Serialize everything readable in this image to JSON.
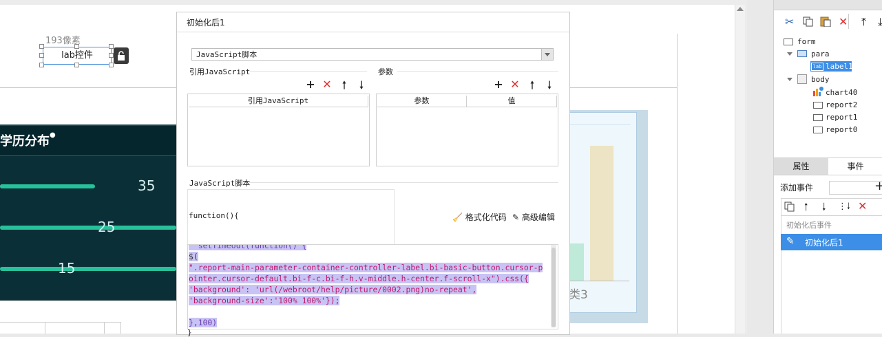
{
  "canvas": {
    "para_label_hint": "193像素",
    "label_widget_text": "lab控件",
    "dark_chart": {
      "title": "学历分布",
      "bars": [
        {
          "value": "35",
          "fill": 0.54,
          "track": 0.76
        },
        {
          "value": "25",
          "fill": 1.0,
          "track": 1.0
        },
        {
          "value": "15",
          "fill": 1.0,
          "track": 1.0
        }
      ],
      "colors": {
        "bg": "#06262d",
        "bar": "#27c19b",
        "track": "#8ee6f2"
      }
    },
    "right_chart": {
      "category_label": "类3"
    }
  },
  "dialog": {
    "title": "初始化后1",
    "script_type": "JavaScript脚本",
    "ref_js_section": "引用JavaScript",
    "params_section": "参数",
    "ref_js_col": "引用JavaScript",
    "param_col": "参数",
    "value_col": "值",
    "script_section": "JavaScript脚本",
    "function_header": "function(){",
    "format_btn": "格式化代码",
    "advanced_btn": "高级编辑",
    "code": {
      "line0": "  setTimeout(function() {",
      "line1": "$(",
      "line2": "\".report-main-parameter-container-controller-label.bi-basic-button.cursor-p",
      "line3": "ointer.cursor-default.bi-f-c.bi-f-h.v-middle.h-center.f-scroll-x\").css({",
      "line4": "'background': 'url(/webroot/help/picture/0002.png)no-repeat',",
      "line5": "'background-size':'100% 100%'});",
      "line6": "",
      "line7": "},100)",
      "line8": "}"
    }
  },
  "side": {
    "tree": {
      "form": "form",
      "para": "para",
      "label10": "label10",
      "body": "body",
      "chart40": "chart40",
      "report2": "report2",
      "report1": "report1",
      "report0": "report0",
      "lab_tag": "lab"
    },
    "tabs": {
      "properties": "属性",
      "events": "事件"
    },
    "add_event_label": "添加事件",
    "event_group": "初始化后事件",
    "event_item": "初始化后1"
  }
}
